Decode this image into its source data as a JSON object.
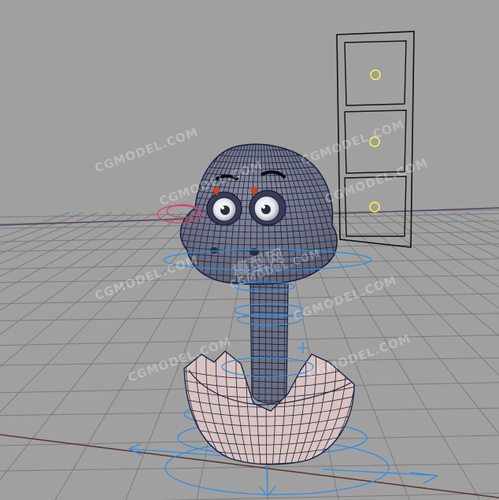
{
  "viewport": {
    "background": "#a0a0a0",
    "grid_color": "#7c7c7c",
    "axis_x_color": "#5a3a2e",
    "axis_z_color": "#5a3d66"
  },
  "model": {
    "shade": "#6d7082",
    "wire": "#1c2140",
    "shell_shade": "#d9c4c0",
    "controller_color": "#2f8fe6",
    "eye_control_color": "#d84060",
    "pin_color": "#cc4422"
  },
  "control_panel": {
    "slider_count": 3,
    "knob_color": "#ffff33"
  },
  "watermark": {
    "text": "CGMODEL.COM",
    "center_text": "模型网"
  }
}
